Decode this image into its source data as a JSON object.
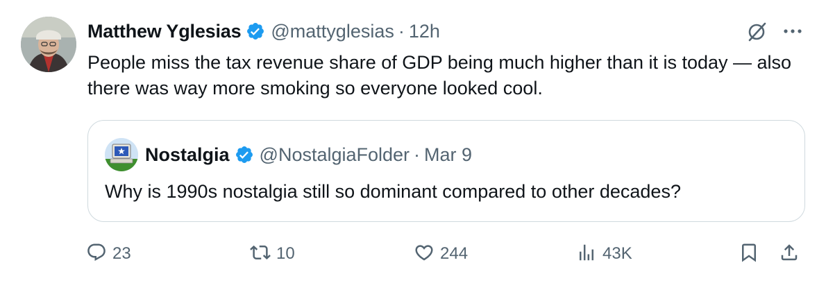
{
  "tweet": {
    "author_name": "Matthew Yglesias",
    "handle": "@mattyglesias",
    "separator": "·",
    "time": "12h",
    "text": "People miss the tax revenue share of GDP being much higher than it is today — also there was way more smoking so everyone looked cool.",
    "verified_color": "#1d9bf0"
  },
  "quoted": {
    "author_name": "Nostalgia",
    "handle": "@NostalgiaFolder",
    "separator": "·",
    "time": "Mar 9",
    "text": "Why is 1990s nostalgia still so dominant compared to other decades?"
  },
  "actions": {
    "replies": "23",
    "reposts": "10",
    "likes": "244",
    "views": "43K"
  },
  "icons": [
    "grok-icon",
    "more-icon",
    "reply-icon",
    "retweet-icon",
    "like-icon",
    "views-icon",
    "bookmark-icon",
    "share-icon",
    "verified-icon"
  ],
  "colors": {
    "text": "#0f1419",
    "secondary": "#536471",
    "border": "#cfd9de",
    "verified": "#1d9bf0"
  }
}
